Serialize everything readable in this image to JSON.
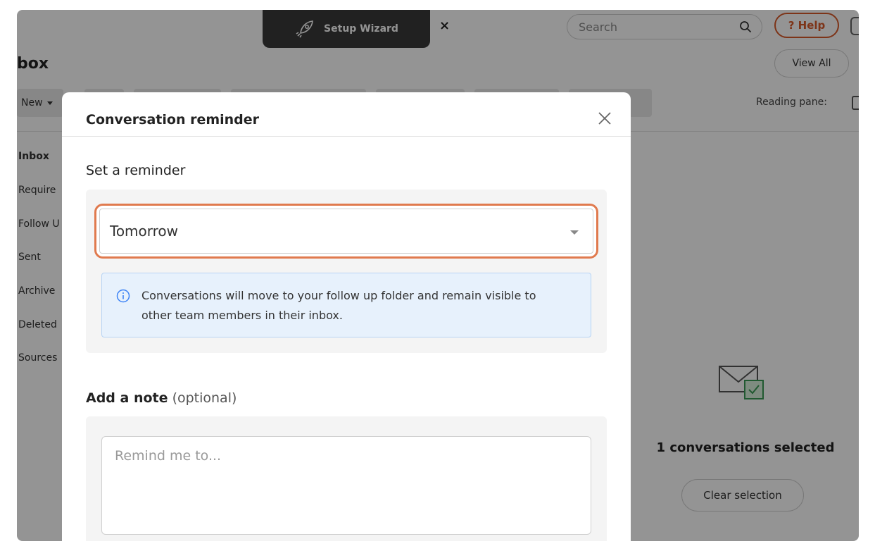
{
  "topbar": {
    "wizard_label": "Setup Wizard",
    "wizard_close": "×",
    "search_placeholder": "Search",
    "help_label": "? Help"
  },
  "page": {
    "title": "box",
    "view_all_label": "View All",
    "new_label": "New",
    "reading_pane_label": "Reading pane:"
  },
  "sidebar": {
    "items": [
      {
        "label": "Inbox"
      },
      {
        "label": "Require"
      },
      {
        "label": "Follow U"
      },
      {
        "label": "Sent"
      },
      {
        "label": "Archive"
      },
      {
        "label": "Deleted"
      },
      {
        "label": "Sources"
      }
    ]
  },
  "selection": {
    "text": "1 conversations selected",
    "clear_label": "Clear selection"
  },
  "modal": {
    "title": "Conversation reminder",
    "close": "×",
    "reminder_label": "Set a reminder",
    "reminder_value": "Tomorrow",
    "info_text": "Conversations will move to your follow up folder and remain visible to other team members in their inbox.",
    "note_label": "Add a note",
    "note_optional": "(optional)",
    "note_placeholder": "Remind me to..."
  },
  "colors": {
    "accent": "#e07a4e",
    "help": "#d75a2a",
    "info_bg": "#e7f1fc",
    "info_icon": "#3b82f6",
    "wizard_bg": "#3a3a3a"
  }
}
